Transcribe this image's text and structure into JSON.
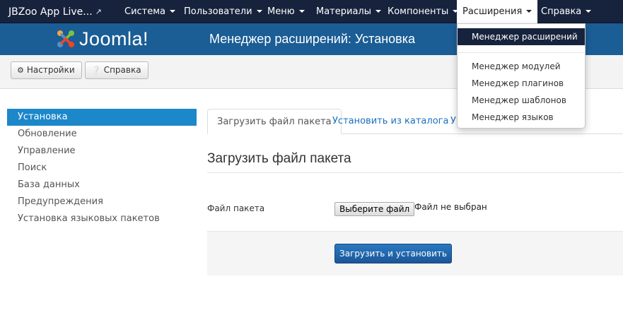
{
  "navbar": {
    "brand": "JBZoo App Live...",
    "items": [
      {
        "label": "Система"
      },
      {
        "label": "Пользователи"
      },
      {
        "label": "Меню"
      },
      {
        "label": "Материалы"
      },
      {
        "label": "Компоненты"
      },
      {
        "label": "Расширения",
        "active": true
      },
      {
        "label": "Справка"
      }
    ]
  },
  "header": {
    "logo_text": "Joomla!",
    "title": "Менеджер расширений: Установка"
  },
  "toolbar": {
    "settings_label": "Настройки",
    "help_label": "Справка"
  },
  "sidebar": {
    "items": [
      {
        "label": "Установка",
        "active": true
      },
      {
        "label": "Обновление"
      },
      {
        "label": "Управление"
      },
      {
        "label": "Поиск"
      },
      {
        "label": "База данных"
      },
      {
        "label": "Предупреждения"
      },
      {
        "label": "Установка языковых пакетов"
      }
    ]
  },
  "tabs": [
    {
      "label": "Загрузить файл пакета",
      "active": true
    },
    {
      "label": "Установить из каталога"
    },
    {
      "label": "У"
    }
  ],
  "main": {
    "section_title": "Загрузить файл пакета",
    "file_label": "Файл пакета",
    "file_button": "Выберите файл",
    "file_status": "Файл не выбран",
    "submit_label": "Загрузить и установить"
  },
  "dropdown": {
    "items": [
      {
        "label": "Менеджер расширений",
        "active": true
      },
      {
        "label": "Менеджер модулей"
      },
      {
        "label": "Менеджер плагинов"
      },
      {
        "label": "Менеджер шаблонов"
      },
      {
        "label": "Менеджер языков"
      }
    ]
  },
  "colors": {
    "navbar": "#17233d",
    "header": "#1b5d95",
    "accent": "#1c87c9",
    "link": "#1a6fbf"
  },
  "icons": {
    "external": "external-link-icon",
    "settings": "gear-icon",
    "help": "question-circle-icon"
  }
}
